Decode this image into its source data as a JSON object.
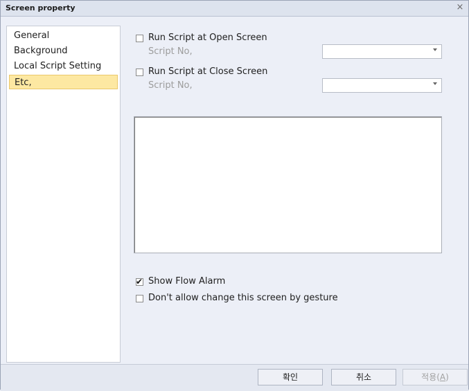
{
  "window": {
    "title": "Screen property",
    "close_glyph": "×"
  },
  "sidebar": {
    "items": [
      {
        "label": "General"
      },
      {
        "label": "Background"
      },
      {
        "label": "Local Script Setting"
      },
      {
        "label": "Etc,",
        "selected": true
      }
    ]
  },
  "script_open": {
    "label": "Run Script at Open Screen",
    "checked": false,
    "sublabel": "Script No,",
    "value": ""
  },
  "script_close": {
    "label": "Run Script at Close Screen",
    "checked": false,
    "sublabel": "Script No,",
    "value": ""
  },
  "notes": {
    "value": ""
  },
  "options": [
    {
      "label": "Show Flow Alarm",
      "checked": true
    },
    {
      "label": "Don't allow change this screen by gesture",
      "checked": false
    }
  ],
  "buttons": {
    "ok": "확인",
    "cancel": "취소",
    "apply_text": "적용(",
    "apply_key": "A",
    "apply_close": ")"
  },
  "colors": {
    "selection": "#fde8a2",
    "dialog_bg": "#eceff7"
  }
}
